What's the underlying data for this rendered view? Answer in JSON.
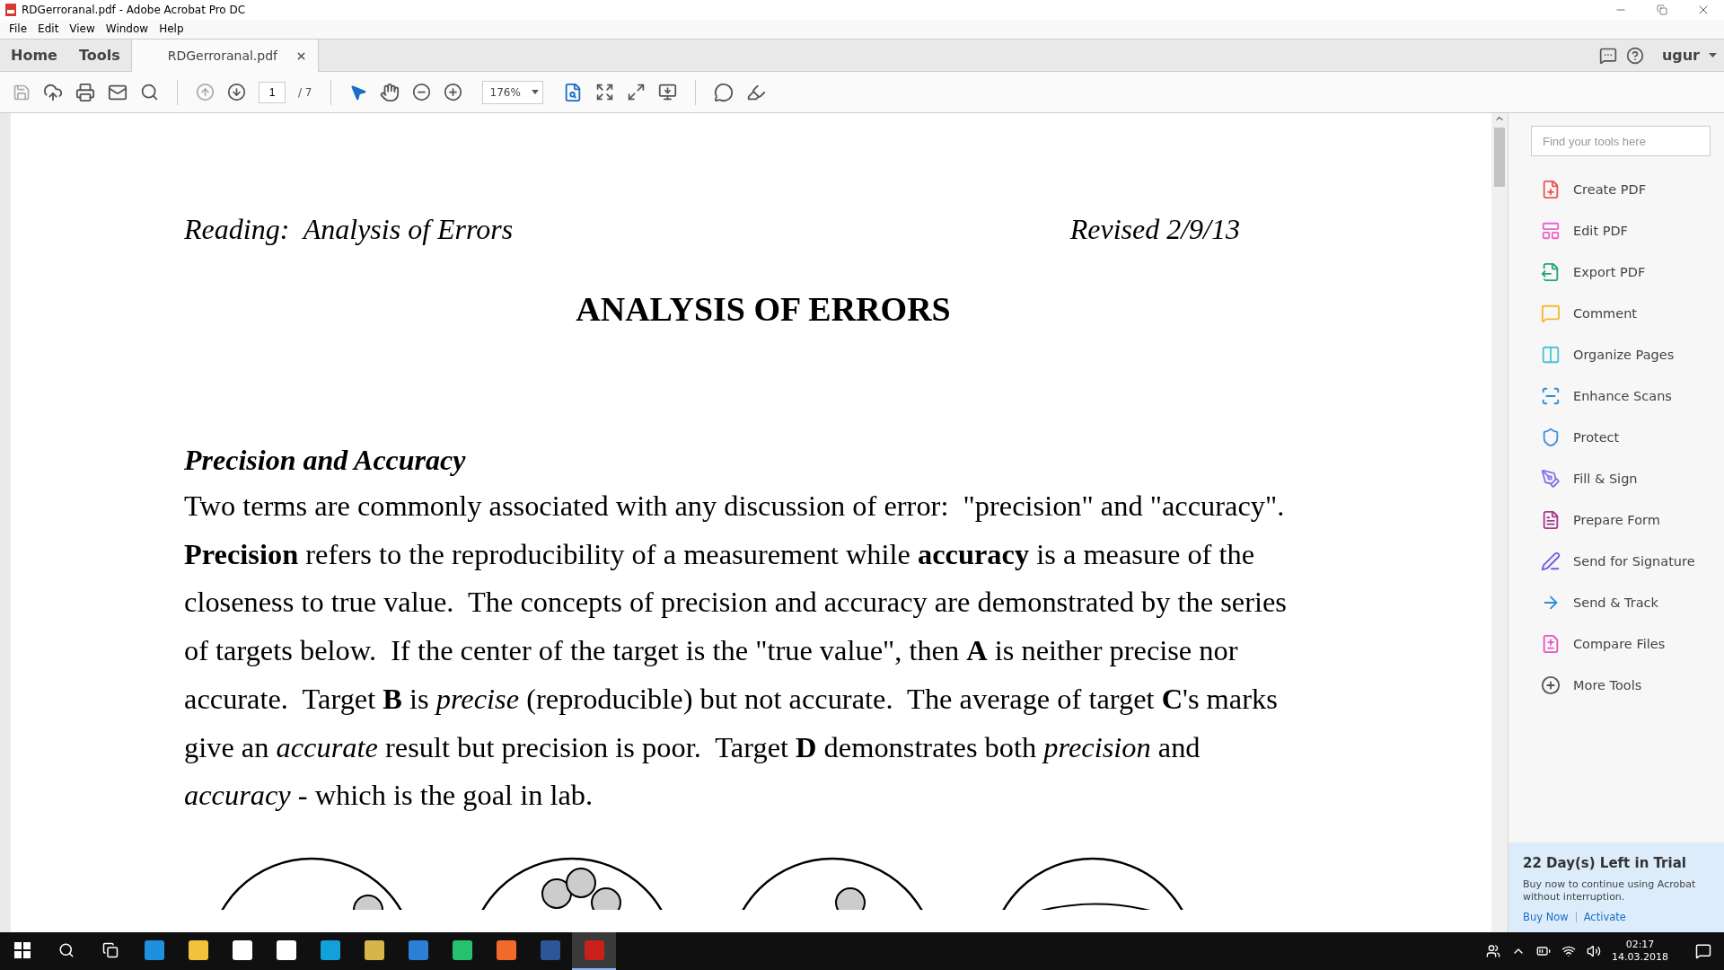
{
  "window": {
    "title": "RDGerroranal.pdf - Adobe Acrobat Pro DC"
  },
  "menu": [
    "File",
    "Edit",
    "View",
    "Window",
    "Help"
  ],
  "tabs": [
    {
      "label": "Home",
      "selected": false
    },
    {
      "label": "Tools",
      "selected": false
    },
    {
      "label": "RDGerroranal.pdf",
      "selected": true
    }
  ],
  "user": "ugur",
  "toolbar": {
    "page_current": "1",
    "page_total": "/ 7",
    "zoom": "176%"
  },
  "document": {
    "header_left": "Reading:  Analysis of Errors",
    "header_right": "Revised 2/9/13",
    "title": "ANALYSIS OF ERRORS",
    "section_heading": "Precision and Accuracy",
    "paragraph": "Two terms are commonly associated with any discussion of error:  \"precision\" and \"accuracy\". **Precision** refers to the reproducibility of a measurement while **accuracy** is a measure of the closeness to true value.  The concepts of precision and accuracy are demonstrated by the series of targets below.  If the center of the target is the \"true value\", then **A** is neither precise nor accurate.  Target **B** is *precise* (reproducible) but not accurate.  The average of target **C**'s marks give an *accurate* result but precision is poor.  Target **D** demonstrates both *precision* and *accuracy* - which is the goal in lab."
  },
  "tools_panel": {
    "search": {
      "placeholder": "Find your tools here"
    },
    "items": [
      {
        "label": "Create PDF",
        "color": "#e8574f"
      },
      {
        "label": "Edit PDF",
        "color": "#e966c8"
      },
      {
        "label": "Export PDF",
        "color": "#27a383"
      },
      {
        "label": "Comment",
        "color": "#f5b731"
      },
      {
        "label": "Organize Pages",
        "color": "#4cc2d6"
      },
      {
        "label": "Enhance Scans",
        "color": "#2a8fd6"
      },
      {
        "label": "Protect",
        "color": "#3f8fe0"
      },
      {
        "label": "Fill & Sign",
        "color": "#8873e6"
      },
      {
        "label": "Prepare Form",
        "color": "#a8388f"
      },
      {
        "label": "Send for Signature",
        "color": "#6a5fe0"
      },
      {
        "label": "Send & Track",
        "color": "#2a8fd6"
      },
      {
        "label": "Compare Files",
        "color": "#e355c3"
      },
      {
        "label": "More Tools",
        "color": "#555555"
      }
    ]
  },
  "trial": {
    "title": "22 Day(s) Left in Trial",
    "text": "Buy now to continue using Acrobat without interruption.",
    "links": [
      "Buy Now",
      "Activate"
    ]
  },
  "taskbar": {
    "apps": [
      {
        "selected": false
      },
      {
        "selected": false
      },
      {
        "selected": false
      },
      {
        "selected": false
      },
      {
        "selected": false
      },
      {
        "selected": false
      },
      {
        "selected": false
      },
      {
        "selected": false
      },
      {
        "selected": false
      },
      {
        "selected": false
      },
      {
        "selected": true
      }
    ],
    "time": "02:17",
    "date": "14.03.2018"
  }
}
